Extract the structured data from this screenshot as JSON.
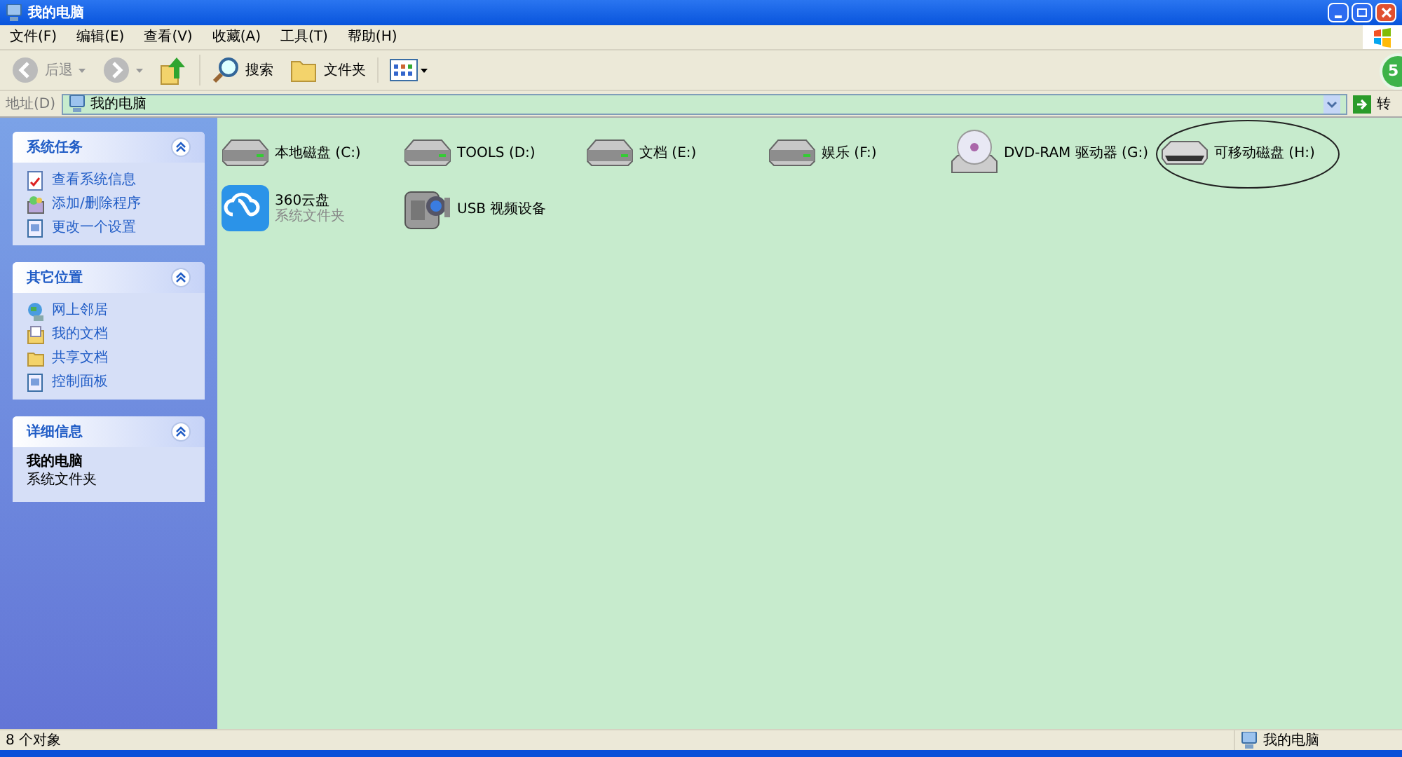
{
  "window": {
    "title": "我的电脑"
  },
  "menu": [
    "文件(F)",
    "编辑(E)",
    "查看(V)",
    "收藏(A)",
    "工具(T)",
    "帮助(H)"
  ],
  "toolbar": [
    {
      "kind": "back",
      "label": "后退",
      "disabled": true
    },
    {
      "kind": "forward",
      "disabled": true
    },
    {
      "kind": "up"
    },
    {
      "kind": "search",
      "label": "搜索"
    },
    {
      "kind": "folders",
      "label": "文件夹"
    },
    {
      "kind": "views"
    }
  ],
  "address": {
    "label": "地址(D)",
    "value": "我的电脑",
    "go": "转"
  },
  "floating_badge": "5",
  "panels": [
    {
      "title": "系统任务",
      "expanded": true,
      "items": [
        {
          "kind": "info",
          "label": "查看系统信息"
        },
        {
          "kind": "programs",
          "label": "添加/删除程序"
        },
        {
          "kind": "settings",
          "label": "更改一个设置"
        }
      ]
    },
    {
      "title": "其它位置",
      "expanded": true,
      "items": [
        {
          "kind": "network",
          "label": "网上邻居"
        },
        {
          "kind": "docs",
          "label": "我的文档"
        },
        {
          "kind": "folder",
          "label": "共享文档"
        },
        {
          "kind": "settings",
          "label": "控制面板"
        }
      ]
    },
    {
      "title": "详细信息",
      "expanded": true,
      "details": {
        "name": "我的电脑",
        "type": "系统文件夹"
      }
    }
  ],
  "items": [
    {
      "kind": "disk",
      "label": "本地磁盘 (C:)",
      "highlighted": false
    },
    {
      "kind": "disk",
      "label": "TOOLS (D:)",
      "highlighted": false
    },
    {
      "kind": "disk",
      "label": "文档 (E:)",
      "highlighted": false
    },
    {
      "kind": "disk",
      "label": "娱乐 (F:)",
      "highlighted": false
    },
    {
      "kind": "dvd",
      "label": "DVD-RAM 驱动器 (G:)",
      "highlighted": false
    },
    {
      "kind": "removable",
      "label": "可移动磁盘 (H:)",
      "highlighted": true
    },
    {
      "kind": "cloud",
      "label": "360云盘",
      "sublabel": "系统文件夹",
      "highlighted": false
    },
    {
      "kind": "camera",
      "label": "USB 视频设备",
      "highlighted": false
    }
  ],
  "status_bar": {
    "left": "8 个对象",
    "right": "我的电脑"
  }
}
